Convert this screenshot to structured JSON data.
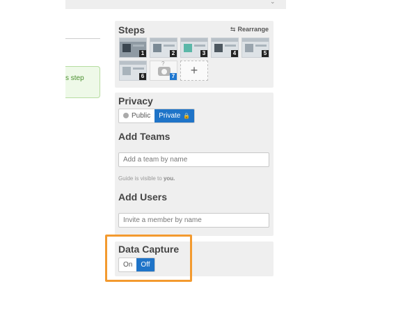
{
  "left_panel": {
    "callout_text": "s step"
  },
  "steps": {
    "title": "Steps",
    "rearrange_label": "Rearrange",
    "thumbnails": [
      {
        "number": "1"
      },
      {
        "number": "2"
      },
      {
        "number": "3"
      },
      {
        "number": "4"
      },
      {
        "number": "5"
      },
      {
        "number": "6"
      },
      {
        "number": "7"
      }
    ],
    "placeholder_mark": "?",
    "add_label": "+"
  },
  "privacy": {
    "title": "Privacy",
    "options": [
      "Public",
      "Private"
    ],
    "selected": "Private"
  },
  "teams": {
    "title": "Add Teams",
    "placeholder": "Add a team by name",
    "visibility_prefix": "Guide is visible to",
    "visibility_target": "you."
  },
  "users": {
    "title": "Add Users",
    "placeholder": "Invite a member by name"
  },
  "data_capture": {
    "title": "Data Capture",
    "options": [
      "On",
      "Off"
    ],
    "selected": "Off"
  },
  "colors": {
    "accent": "#1f74c8",
    "highlight": "#f39a2f",
    "panel_bg": "#efefef",
    "callout_bg": "#eef9e8"
  }
}
